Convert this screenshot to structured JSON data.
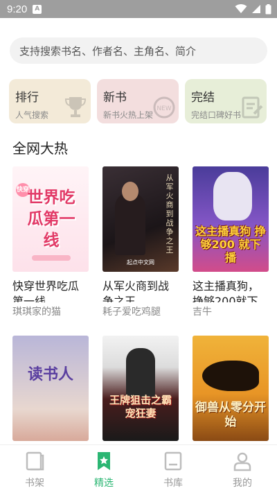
{
  "status": {
    "time": "9:20",
    "notif": "A"
  },
  "search": {
    "placeholder": "支持搜索书名、作者名、主角名、简介"
  },
  "cards": [
    {
      "title": "排行",
      "subtitle": "人气搜索",
      "icon": "trophy-icon"
    },
    {
      "title": "新书",
      "subtitle": "新书火热上架",
      "icon": "new-badge-icon"
    },
    {
      "title": "完结",
      "subtitle": "完结口碑好书",
      "icon": "finished-clipboard-icon"
    }
  ],
  "section_title": "全网大热",
  "books": [
    {
      "title": "快穿世界吃瓜第一线",
      "author": "琪琪家的猫",
      "cover_text": "世界吃瓜第一线",
      "cover_tag": "快穿"
    },
    {
      "title": "从军火商到战争之王",
      "author": "耗子爱吃鸡腿",
      "cover_text": "从军火商到战争之王",
      "cover_badge": "起点中文网"
    },
    {
      "title": "这主播真狗，挣够200就下播",
      "author": "吉牛",
      "cover_text": "这主播真狗 挣够200 就下播"
    },
    {
      "title": "",
      "author": "",
      "cover_text": "读书人"
    },
    {
      "title": "",
      "author": "",
      "cover_text": "王牌狙击之霸宠狂妻"
    },
    {
      "title": "",
      "author": "",
      "cover_text": "御兽从零分开始"
    }
  ],
  "tabs": [
    {
      "label": "书架",
      "icon": "bookshelf-icon"
    },
    {
      "label": "精选",
      "icon": "featured-icon",
      "active": true
    },
    {
      "label": "书库",
      "icon": "library-icon"
    },
    {
      "label": "我的",
      "icon": "profile-icon"
    }
  ]
}
